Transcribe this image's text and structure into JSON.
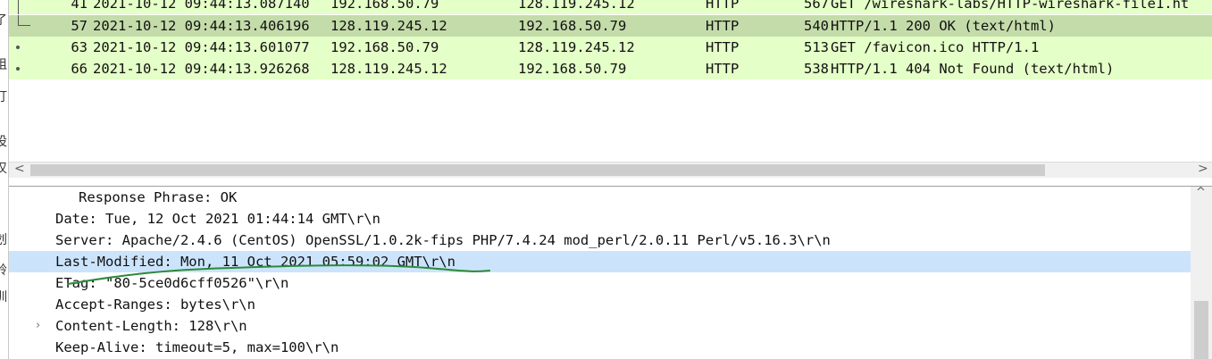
{
  "left_strip_glyphs": [
    "了",
    "姐",
    "汀",
    "设",
    "汉",
    "划",
    "铃",
    "训"
  ],
  "packet_list": {
    "rows": [
      {
        "no": "41",
        "time": "2021-10-12 09:44:13.087140",
        "source": "192.168.50.79",
        "destination": "128.119.245.12",
        "protocol": "HTTP",
        "length": "567",
        "info": "GET /wireshark-labs/HTTP-wireshark-file1.ht",
        "selected": false
      },
      {
        "no": "57",
        "time": "2021-10-12 09:44:13.406196",
        "source": "128.119.245.12",
        "destination": "192.168.50.79",
        "protocol": "HTTP",
        "length": "540",
        "info": "HTTP/1.1 200 OK  (text/html)",
        "selected": true
      },
      {
        "no": "63",
        "time": "2021-10-12 09:44:13.601077",
        "source": "192.168.50.79",
        "destination": "128.119.245.12",
        "protocol": "HTTP",
        "length": "513",
        "info": "GET /favicon.ico HTTP/1.1",
        "selected": false
      },
      {
        "no": "66",
        "time": "2021-10-12 09:44:13.926268",
        "source": "128.119.245.12",
        "destination": "192.168.50.79",
        "protocol": "HTTP",
        "length": "538",
        "info": "HTTP/1.1 404 Not Found  (text/html)",
        "selected": false
      }
    ],
    "row_colors": {
      "normal": "#e4ffc7",
      "selected": "#c4dcaa"
    }
  },
  "scrollbar": {
    "left_arrow": "<",
    "right_arrow": ">",
    "up_arrow": "^"
  },
  "details": {
    "lines": [
      {
        "text": "Response Phrase: OK",
        "indent": 2,
        "expandable": false,
        "highlighted": false
      },
      {
        "text": "Date: Tue, 12 Oct 2021 01:44:14 GMT\\r\\n",
        "indent": 1,
        "expandable": false,
        "highlighted": false
      },
      {
        "text": "Server: Apache/2.4.6 (CentOS) OpenSSL/1.0.2k-fips PHP/7.4.24 mod_perl/2.0.11 Perl/v5.16.3\\r\\n",
        "indent": 1,
        "expandable": false,
        "highlighted": false
      },
      {
        "text": "Last-Modified: Mon, 11 Oct 2021 05:59:02 GMT\\r\\n",
        "indent": 1,
        "expandable": false,
        "highlighted": true
      },
      {
        "text": "ETag: \"80-5ce0d6cff0526\"\\r\\n",
        "indent": 1,
        "expandable": false,
        "highlighted": false
      },
      {
        "text": "Accept-Ranges: bytes\\r\\n",
        "indent": 1,
        "expandable": false,
        "highlighted": false
      },
      {
        "text": "Content-Length: 128\\r\\n",
        "indent": 1,
        "expandable": true,
        "highlighted": false
      },
      {
        "text": "Keep-Alive: timeout=5, max=100\\r\\n",
        "indent": 1,
        "expandable": false,
        "highlighted": false
      }
    ],
    "highlight_color": "#cce4fb",
    "annotation_color": "#2a8a3a"
  }
}
